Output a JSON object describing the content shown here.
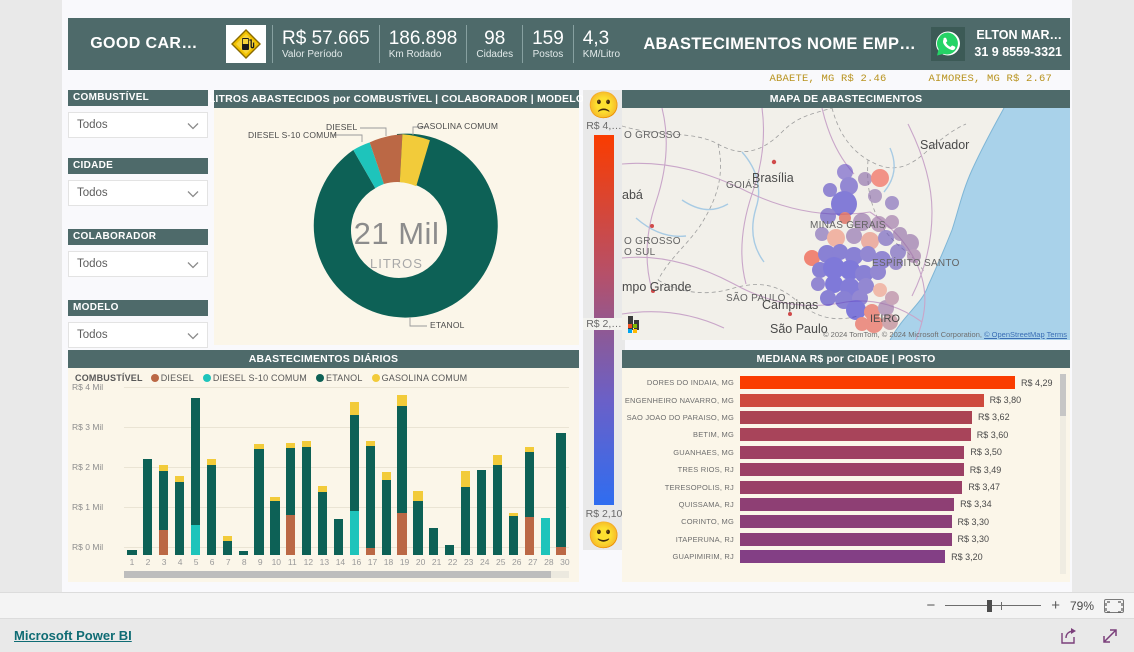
{
  "header": {
    "brand": "GOOD CAR…",
    "logo_icon": "fuel-warning-sign-icon",
    "title": "ABASTECIMENTOS NOME EMP…",
    "kpis": [
      {
        "value": "R$ 57.665",
        "label": "Valor Período"
      },
      {
        "value": "186.898",
        "label": "Km Rodado"
      },
      {
        "value": "98",
        "label": "Cidades"
      },
      {
        "value": "159",
        "label": "Postos"
      },
      {
        "value": "4,3",
        "label": "KM/Litro"
      }
    ],
    "contact": {
      "icon": "whatsapp-icon",
      "name": "ELTON MAR…",
      "phone": "31 9 8559-3321"
    }
  },
  "ticker": {
    "items": [
      "ABAETE, MG R$ 2.46",
      "AIMORES, MG R$ 2.67"
    ],
    "color": "#b8931f"
  },
  "slicers": [
    {
      "title": "COMBUSTÍVEL",
      "value": "Todos",
      "icon": "chevron-down-icon"
    },
    {
      "title": "CIDADE",
      "value": "Todos",
      "icon": "chevron-down-icon"
    },
    {
      "title": "COLABORADOR",
      "value": "Todos",
      "icon": "chevron-down-icon"
    },
    {
      "title": "MODELO",
      "value": "Todos",
      "icon": "chevron-down-icon"
    }
  ],
  "donut": {
    "title": "LITROS ABASTECIDOS por COMBUSTÍVEL | COLABORADOR | MODELO",
    "center_value": "21 Mil",
    "center_label": "LITROS",
    "labels": {
      "diesel_s10": "DIESEL S-10 COMUM",
      "diesel": "DIESEL",
      "gasolina": "GASOLINA COMUM",
      "etanol": "ETANOL"
    }
  },
  "gauge": {
    "top_face": "slight-frown-face-icon",
    "bottom_face": "smiling-face-icon",
    "top_label": "R$ 4,…",
    "mid_label": "R$ 2,…",
    "bottom_label": "R$ 2,10",
    "gradient_top": "#fa3c00",
    "gradient_bottom": "#2f6df0"
  },
  "map": {
    "title": "MAPA DE ABASTECIMENTOS",
    "region_labels": [
      "O GROSSO",
      "GOIÁS",
      "O GROSSO\nO SUL",
      "MINAS GERAIS",
      "ESPÍRITO SANTO",
      "SÃO PAULO"
    ],
    "city_labels": [
      "Salvador",
      "Brasília",
      "abá",
      "mpo Grande",
      "Campinas",
      "São Paulo",
      "IEIRO"
    ],
    "provider_logo": "microsoft-bing-logo",
    "attribution": "© 2024 TomTom, © 2024 Microsoft Corporation,",
    "attribution_link1": "© OpenStreetMap",
    "attribution_link2": "Terms"
  },
  "footer": {
    "link": "Microsoft Power BI",
    "share_icon": "share-icon",
    "fullscreen_icon": "expand-arrows-icon"
  },
  "toolbar": {
    "zoom_out_icon": "minus-icon",
    "zoom_in_icon": "plus-icon",
    "zoom_value": "79%",
    "fit_icon": "fit-to-page-icon"
  },
  "chart_data": [
    {
      "type": "pie",
      "title": "LITROS ABASTECIDOS por COMBUSTÍVEL | COLABORADOR | MODELO",
      "center_text": "21 Mil",
      "center_subtext": "LITROS",
      "labels": [
        "ETANOL",
        "DIESEL S-10 COMUM",
        "DIESEL",
        "GASOLINA COMUM"
      ],
      "values": [
        83.5,
        4.5,
        7.0,
        5.0
      ],
      "unit": "percent",
      "colors": [
        "#0d6156",
        "#1ec4bb",
        "#bb6845",
        "#f2cb3a"
      ],
      "legend": "labeled-callouts"
    },
    {
      "type": "bar",
      "title": "ABASTECIMENTOS DIÁRIOS",
      "stacked": true,
      "legend_title": "COMBUSTÍVEL",
      "legend": [
        "DIESEL",
        "DIESEL S-10 COMUM",
        "ETANOL",
        "GASOLINA COMUM"
      ],
      "colors": [
        "#bb6845",
        "#1ec4bb",
        "#0d6156",
        "#f2cb3a"
      ],
      "xlabel": "",
      "ylabel": "",
      "ylim": [
        0,
        4000
      ],
      "ytick_labels": [
        "R$ 0 Mil",
        "R$ 1 Mil",
        "R$ 2 Mil",
        "R$ 3 Mil",
        "R$ 4 Mil"
      ],
      "ytick_values": [
        0,
        1000,
        2000,
        3000,
        4000
      ],
      "categories": [
        "1",
        "2",
        "3",
        "4",
        "5",
        "6",
        "7",
        "8",
        "9",
        "10",
        "11",
        "12",
        "13",
        "14",
        "16",
        "17",
        "18",
        "19",
        "20",
        "21",
        "22",
        "23",
        "24",
        "25",
        "26",
        "27",
        "28",
        "30"
      ],
      "series": [
        {
          "name": "DIESEL",
          "values": [
            0,
            0,
            620,
            0,
            0,
            0,
            0,
            0,
            0,
            0,
            1000,
            0,
            0,
            0,
            0,
            175,
            0,
            1040,
            0,
            0,
            0,
            0,
            0,
            0,
            0,
            960,
            0,
            190
          ]
        },
        {
          "name": "DIESEL S-10 COMUM",
          "values": [
            0,
            0,
            0,
            0,
            760,
            0,
            0,
            0,
            0,
            0,
            0,
            0,
            0,
            0,
            1090,
            0,
            0,
            0,
            0,
            0,
            0,
            0,
            0,
            0,
            0,
            0,
            930,
            0
          ]
        },
        {
          "name": "ETANOL",
          "values": [
            125,
            2410,
            1490,
            1830,
            3170,
            2260,
            345,
            90,
            2645,
            1355,
            1680,
            2690,
            1570,
            900,
            2400,
            2560,
            1870,
            2680,
            1340,
            680,
            240,
            1690,
            2120,
            2240,
            965,
            1610,
            0,
            2870
          ]
        },
        {
          "name": "GASOLINA COMUM",
          "values": [
            0,
            0,
            140,
            150,
            0,
            150,
            140,
            0,
            120,
            100,
            120,
            160,
            160,
            0,
            340,
            110,
            200,
            290,
            260,
            0,
            0,
            420,
            0,
            260,
            90,
            120,
            0,
            0
          ]
        }
      ]
    },
    {
      "type": "bar",
      "orientation": "horizontal",
      "title": "MEDIANA R$ por CIDADE | POSTO",
      "xlabel": "",
      "ylabel": "",
      "xlim": [
        0,
        4.29
      ],
      "categories": [
        "DORES DO INDAIA, MG",
        "ENGENHEIRO NAVARRO, MG",
        "SAO JOAO DO PARAISO, MG",
        "BETIM, MG",
        "GUANHAES, MG",
        "TRES RIOS, RJ",
        "TERESOPOLIS, RJ",
        "QUISSAMA, RJ",
        "CORINTO, MG",
        "ITAPERUNA, RJ",
        "GUAPIMIRIM, RJ"
      ],
      "values": [
        4.29,
        3.8,
        3.62,
        3.6,
        3.5,
        3.49,
        3.47,
        3.34,
        3.3,
        3.3,
        3.2
      ],
      "data_labels": [
        "R$ 4,29",
        "R$ 3,80",
        "R$ 3,62",
        "R$ 3,60",
        "R$ 3,50",
        "R$ 3,49",
        "R$ 3,47",
        "R$ 3,34",
        "R$ 3,30",
        "R$ 3,30",
        "R$ 3,20"
      ],
      "colors": [
        "#fa3c00",
        "#ce4a3d",
        "#ab4453",
        "#a8445a",
        "#9e4063",
        "#9c4065",
        "#9a4067",
        "#8e3f74",
        "#8b3f78",
        "#8b3f78",
        "#833f85"
      ]
    },
    {
      "type": "scatter",
      "title": "MAPA DE ABASTECIMENTOS",
      "subtype": "bubble-map",
      "color_scale_low": "#2f6df0",
      "color_scale_high": "#fa3c00",
      "legend_low": "R$ 2,10",
      "legend_high": "R$ 4,…",
      "legend_mid": "R$ 2,…"
    }
  ]
}
